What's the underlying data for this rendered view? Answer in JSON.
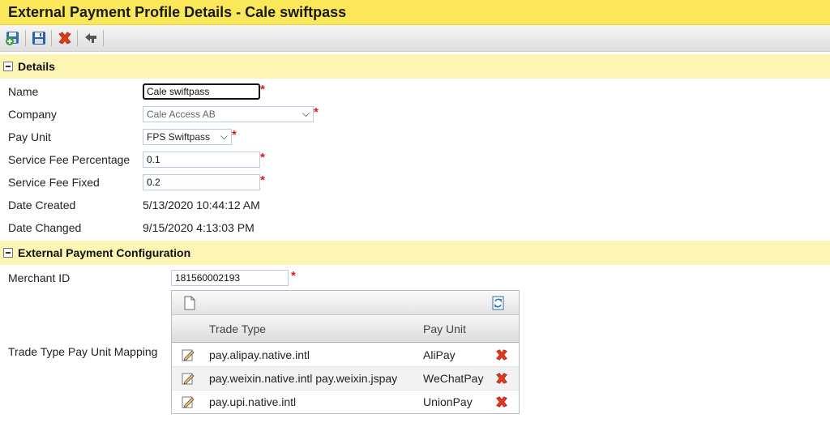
{
  "window": {
    "title": "External Payment Profile Details - Cale swiftpass"
  },
  "toolbar": {
    "buttons": [
      {
        "name": "save-and-new",
        "icon": "save-add-icon"
      },
      {
        "name": "save",
        "icon": "floppy-disk-icon"
      },
      {
        "name": "delete",
        "icon": "red-x-icon"
      },
      {
        "name": "back",
        "icon": "back-arrow-icon"
      }
    ]
  },
  "details": {
    "header": "Details",
    "name_label": "Name",
    "name_value": "Cale swiftpass",
    "company_label": "Company",
    "company_value": "Cale Access AB",
    "payunit_label": "Pay Unit",
    "payunit_value": "FPS Swiftpass",
    "fee_pct_label": "Service Fee Percentage",
    "fee_pct_value": "0.1",
    "fee_fixed_label": "Service Fee Fixed",
    "fee_fixed_value": "0.2",
    "date_created_label": "Date Created",
    "date_created_value": "5/13/2020 10:44:12 AM",
    "date_changed_label": "Date Changed",
    "date_changed_value": "9/15/2020 4:13:03 PM",
    "required_mark": "*"
  },
  "config": {
    "header": "External Payment Configuration",
    "merchant_label": "Merchant ID",
    "merchant_value": "181560002193",
    "mapping_label": "Trade Type Pay Unit Mapping",
    "grid": {
      "col_trade_type": "Trade Type",
      "col_pay_unit": "Pay Unit",
      "rows": [
        {
          "trade_type": "pay.alipay.native.intl",
          "pay_unit": "AliPay"
        },
        {
          "trade_type": "pay.weixin.native.intl pay.weixin.jspay",
          "pay_unit": "WeChatPay"
        },
        {
          "trade_type": "pay.upi.native.intl",
          "pay_unit": "UnionPay"
        }
      ]
    }
  },
  "colors": {
    "title_bar": "#fbe85a",
    "section_header": "#fdf5b3",
    "required": "#e01a1a",
    "delete_icon": "#e03a1a"
  }
}
